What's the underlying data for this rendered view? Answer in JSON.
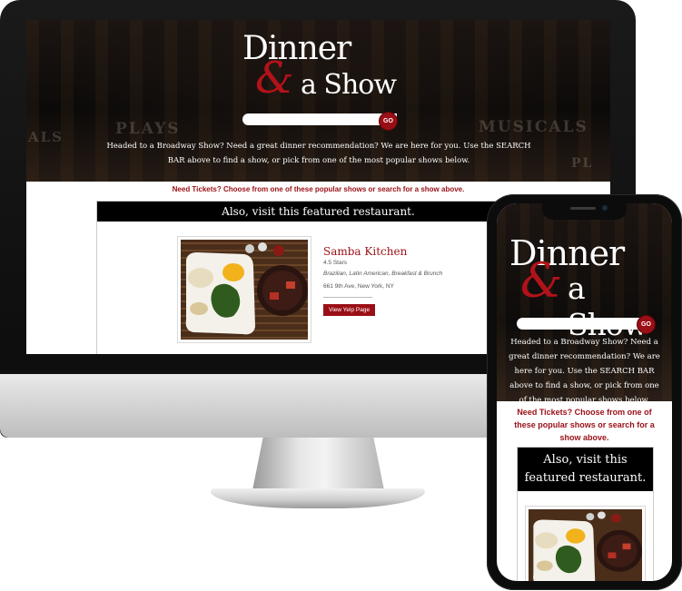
{
  "site": {
    "logo_word_1": "Dinner",
    "logo_amp": "&",
    "logo_word_2": "a Show",
    "search_go_label": "GO",
    "search_placeholder": "",
    "intro_text": "Headed to a Broadway Show? Need a great dinner recommendation? We are here for you. Use the SEARCH BAR above to find a show, or pick from one of the most popular shows below.",
    "background_signs": [
      "PLAYS",
      "ALS",
      "MUSICALS",
      "PL"
    ],
    "tickets_text": "Need Tickets? Choose from one of these popular shows or search for a show above.",
    "featured_heading": "Also, visit this featured restaurant."
  },
  "restaurant": {
    "name": "Samba Kitchen",
    "stars": "4.5 Stars",
    "categories": "Brazilian, Latin American, Breakfast & Brunch",
    "address": "661 9th Ave, New York, NY",
    "button_label": "View Yelp Page",
    "photo_icon": "food-plate-photo"
  },
  "colors": {
    "brand_red": "#9a0f16",
    "hero_dark": "#0c0a09",
    "text_white": "#ffffff"
  }
}
